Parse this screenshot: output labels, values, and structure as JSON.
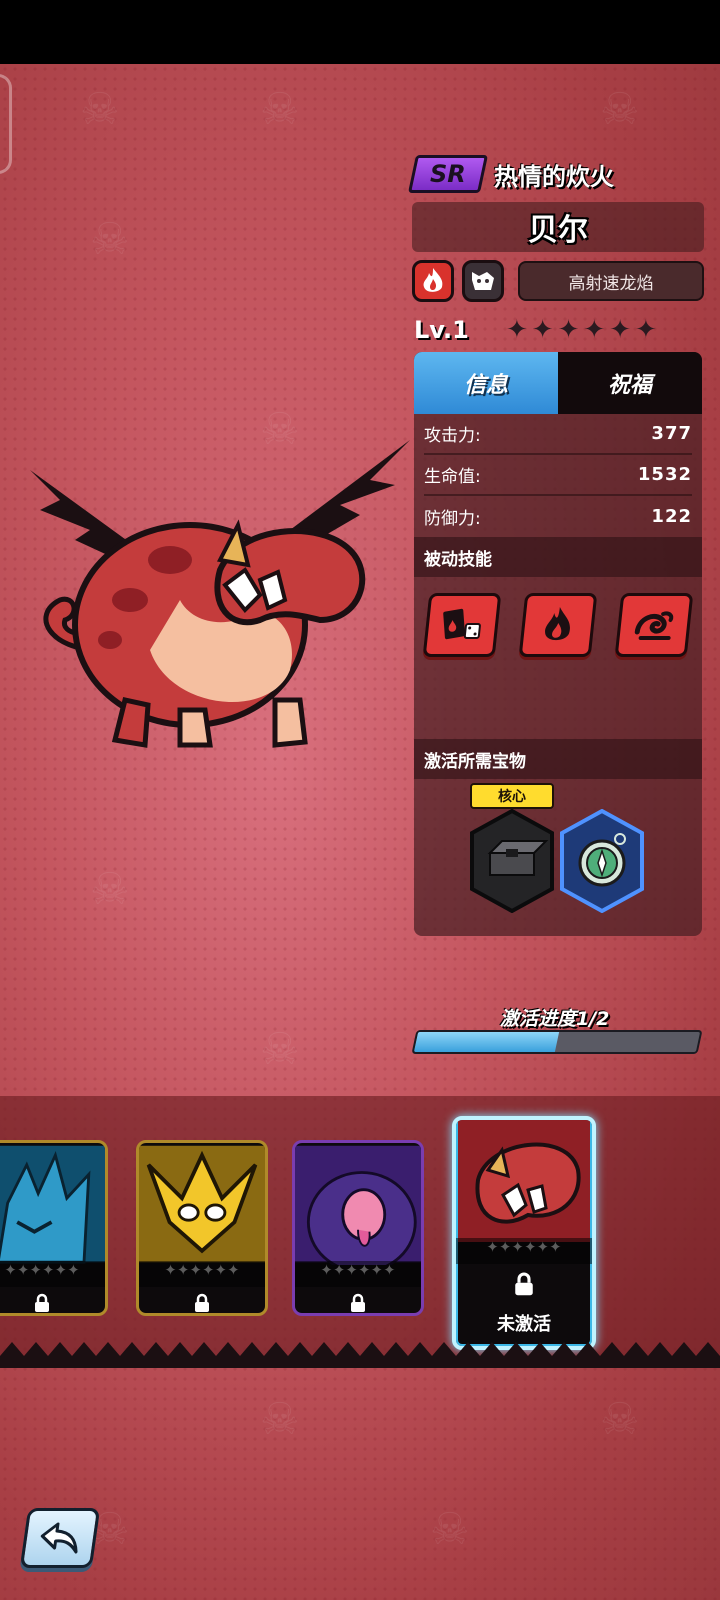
{
  "character": {
    "rarity": "SR",
    "title": "热情的炊火",
    "name": "贝尔",
    "element_icon": "fire-icon",
    "type_icon": "beast-face-icon",
    "skill_name": "高射速龙焰",
    "level": "Lv.1",
    "stars_total": 6,
    "stars_filled": 0
  },
  "tabs": [
    {
      "label": "信息",
      "active": true
    },
    {
      "label": "祝福",
      "active": false
    }
  ],
  "stats": [
    {
      "label": "攻击力:",
      "value": "377"
    },
    {
      "label": "生命值:",
      "value": "1532"
    },
    {
      "label": "防御力:",
      "value": "122"
    }
  ],
  "passive": {
    "title": "被动技能",
    "skills": [
      "cards-dice-icon",
      "flame-icon",
      "wind-swirl-icon"
    ]
  },
  "treasures": {
    "title": "激活所需宝物",
    "core_tag": "核心",
    "items": [
      "dark-box-treasure-icon",
      "compass-treasure-icon"
    ]
  },
  "activation": {
    "label": "激活进度1/2",
    "progress": 0.5
  },
  "cards": [
    {
      "art": "blue-ice-beast",
      "locked": true,
      "status": ""
    },
    {
      "art": "yellow-spiky-beast",
      "locked": true,
      "status": ""
    },
    {
      "art": "purple-ghost-beast",
      "locked": true,
      "status": ""
    },
    {
      "art": "red-dragon-bell",
      "locked": true,
      "selected": true,
      "status": "未激活"
    }
  ],
  "colors": {
    "background": "#c4565f",
    "rarity_sr": "#9b45e0",
    "tab_active": "#3b96dc",
    "progress_fill": "#58b4e8",
    "selected_card_border": "#bff3ff",
    "core_tag": "#ffdc2e"
  }
}
